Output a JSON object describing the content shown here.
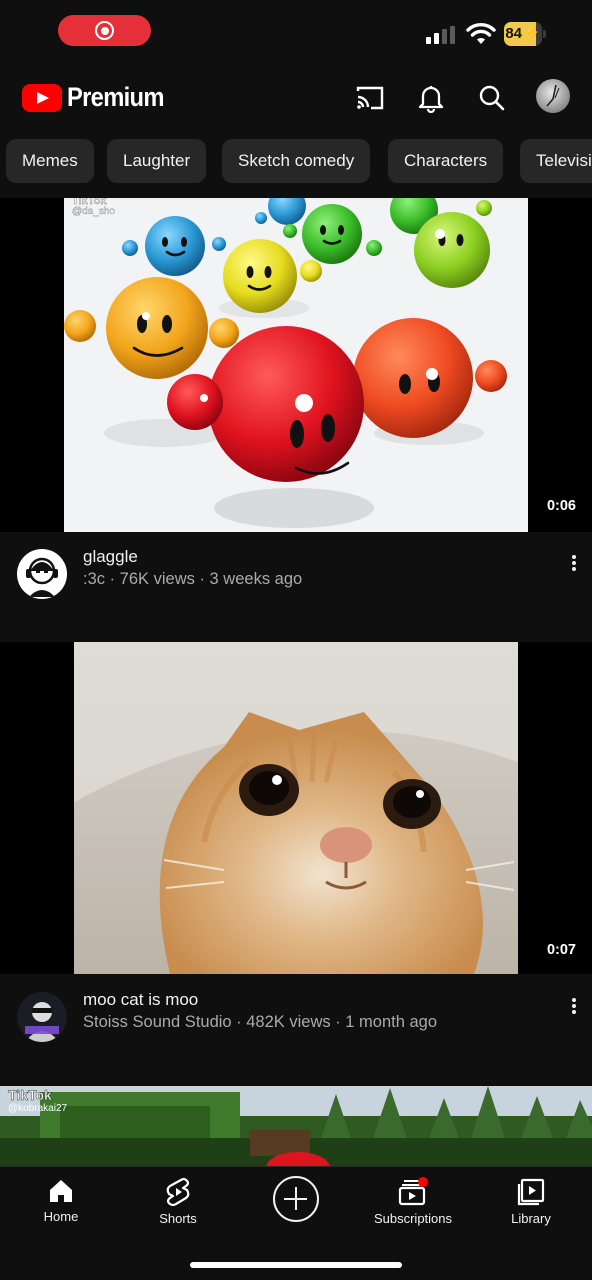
{
  "status_bar": {
    "battery_text": "84",
    "battery_level": 0.84,
    "battery_color": "#f2c94c",
    "recording_color": "#e5303a"
  },
  "header": {
    "logo_text": "Premium",
    "brand_color": "#ff0000",
    "icons": [
      "cast-icon",
      "bell-icon",
      "search-icon",
      "avatar"
    ]
  },
  "chips": [
    "Memes",
    "Laughter",
    "Sketch comedy",
    "Characters",
    "Television"
  ],
  "videos": [
    {
      "overlay_text": "TikTok",
      "overlay_handle": "@da_sho",
      "duration": "0:06",
      "title": "glaggle",
      "subtitle": ":3c · 76K views · 3 weeks ago"
    },
    {
      "duration": "0:07",
      "title": "moo cat is moo",
      "subtitle": "Stoiss Sound Studio · 482K views · 1 month ago"
    },
    {
      "overlay_text": "TikTok",
      "overlay_handle": "@kobrakai27"
    }
  ],
  "bottom_nav": {
    "home": "Home",
    "shorts": "Shorts",
    "create_icon": "plus-circle-icon",
    "subscriptions": "Subscriptions",
    "library": "Library",
    "notification_dot_color": "#ff0000"
  }
}
